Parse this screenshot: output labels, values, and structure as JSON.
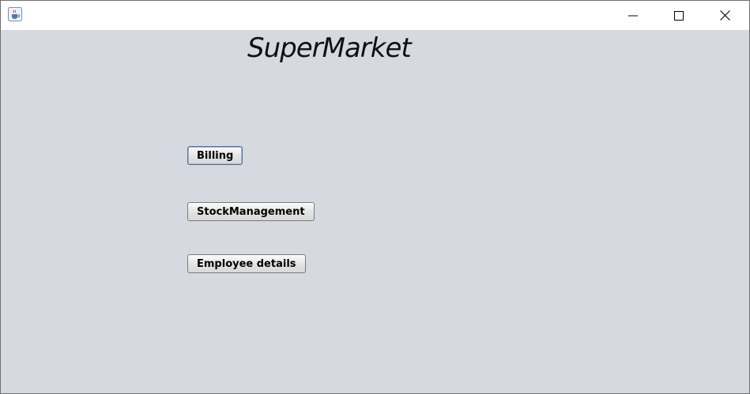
{
  "window": {
    "title": "",
    "icon": "java-cup-icon",
    "controls": {
      "minimize": "minimize-icon",
      "maximize": "maximize-icon",
      "close": "close-icon"
    }
  },
  "main": {
    "heading": "SuperMarket",
    "buttons": [
      {
        "label": "Billing",
        "focused": true
      },
      {
        "label": "StockManagement",
        "focused": false
      },
      {
        "label": "Employee details",
        "focused": false
      }
    ]
  },
  "colors": {
    "background": "#d6d9e0",
    "titlebar": "#ffffff",
    "text": "#111111"
  }
}
